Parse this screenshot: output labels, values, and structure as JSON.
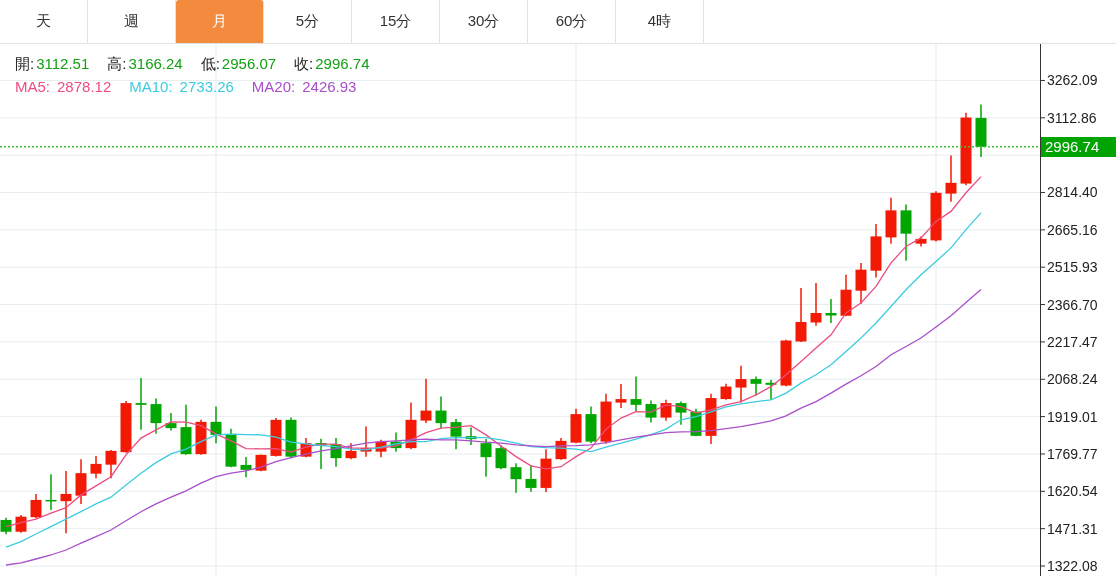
{
  "tabs": [
    {
      "label": "天",
      "selected": false
    },
    {
      "label": "週",
      "selected": false
    },
    {
      "label": "月",
      "selected": true
    },
    {
      "label": "5分",
      "selected": false
    },
    {
      "label": "15分",
      "selected": false
    },
    {
      "label": "30分",
      "selected": false
    },
    {
      "label": "60分",
      "selected": false
    },
    {
      "label": "4時",
      "selected": false
    }
  ],
  "chart": {
    "ohlc_legend": [
      {
        "label": "開:",
        "value": "3112.51"
      },
      {
        "label": "高:",
        "value": "3166.24"
      },
      {
        "label": "低:",
        "value": "2956.07"
      },
      {
        "label": "收:",
        "value": "2996.74"
      }
    ],
    "ma_legend": [
      {
        "value": "2878.12"
      },
      {
        "value": "2733.26"
      },
      {
        "value": "2426.93"
      }
    ],
    "chart_data": {
      "type": "candlestick",
      "grid": true,
      "ylim": [
        1282.1,
        3407.7
      ],
      "yticks": [
        1322.08,
        1471.31,
        1620.54,
        1769.77,
        1919.01,
        2068.24,
        2217.47,
        {
          "value": 2366.7,
          "label": "2366.70"
        },
        2515.93,
        2665.16,
        {
          "value": 2814.4,
          "label": "2814.40"
        },
        3112.86,
        3262.09
      ],
      "ohlc": [
        [
          1506,
          1515,
          1449,
          1459
        ],
        [
          1459,
          1526,
          1455,
          1519
        ],
        [
          1517,
          1610,
          1513,
          1586
        ],
        [
          1586,
          1689,
          1546,
          1581
        ],
        [
          1581,
          1702,
          1453,
          1610
        ],
        [
          1603,
          1749,
          1570,
          1693
        ],
        [
          1691,
          1762,
          1673,
          1730
        ],
        [
          1727,
          1786,
          1673,
          1782
        ],
        [
          1777,
          1981,
          1775,
          1973
        ],
        [
          1973,
          2073,
          1866,
          1966
        ],
        [
          1969,
          1991,
          1850,
          1893
        ],
        [
          1893,
          1933,
          1863,
          1873
        ],
        [
          1877,
          1966,
          1767,
          1769
        ],
        [
          1769,
          1906,
          1767,
          1898
        ],
        [
          1898,
          1959,
          1813,
          1846
        ],
        [
          1850,
          1870,
          1717,
          1719
        ],
        [
          1726,
          1758,
          1677,
          1706
        ],
        [
          1703,
          1768,
          1701,
          1766
        ],
        [
          1762,
          1913,
          1760,
          1906
        ],
        [
          1906,
          1915,
          1753,
          1759
        ],
        [
          1759,
          1833,
          1757,
          1813
        ],
        [
          1813,
          1830,
          1710,
          1803
        ],
        [
          1809,
          1833,
          1719,
          1753
        ],
        [
          1753,
          1813,
          1749,
          1782
        ],
        [
          1779,
          1879,
          1759,
          1793
        ],
        [
          1779,
          1826,
          1757,
          1819
        ],
        [
          1819,
          1855,
          1779,
          1793
        ],
        [
          1793,
          1975,
          1789,
          1906
        ],
        [
          1903,
          2070,
          1893,
          1943
        ],
        [
          1943,
          1999,
          1873,
          1893
        ],
        [
          1897,
          1909,
          1789,
          1839
        ],
        [
          1841,
          1875,
          1806,
          1829
        ],
        [
          1813,
          1829,
          1679,
          1757
        ],
        [
          1793,
          1805,
          1709,
          1713
        ],
        [
          1717,
          1733,
          1615,
          1669
        ],
        [
          1670,
          1725,
          1619,
          1634
        ],
        [
          1634,
          1789,
          1618,
          1751
        ],
        [
          1749,
          1833,
          1747,
          1822
        ],
        [
          1815,
          1950,
          1813,
          1929
        ],
        [
          1929,
          1959,
          1813,
          1819
        ],
        [
          1819,
          2010,
          1811,
          1979
        ],
        [
          1975,
          2049,
          1953,
          1989
        ],
        [
          1989,
          2079,
          1939,
          1966
        ],
        [
          1969,
          1983,
          1895,
          1915
        ],
        [
          1915,
          1986,
          1902,
          1973
        ],
        [
          1973,
          1979,
          1886,
          1935
        ],
        [
          1939,
          1950,
          1840,
          1842
        ],
        [
          1842,
          2010,
          1810,
          1993
        ],
        [
          1989,
          2050,
          1986,
          2039
        ],
        [
          2035,
          2122,
          1975,
          2069
        ],
        [
          2069,
          2079,
          2002,
          2050
        ],
        [
          2054,
          2066,
          1986,
          2046
        ],
        [
          2043,
          2226,
          2040,
          2223
        ],
        [
          2219,
          2433,
          2217,
          2297
        ],
        [
          2295,
          2453,
          2282,
          2333
        ],
        [
          2333,
          2389,
          2293,
          2323
        ],
        [
          2322,
          2486,
          2320,
          2426
        ],
        [
          2422,
          2533,
          2370,
          2506
        ],
        [
          2502,
          2689,
          2475,
          2639
        ],
        [
          2635,
          2793,
          2610,
          2743
        ],
        [
          2743,
          2766,
          2542,
          2650
        ],
        [
          2610,
          2639,
          2599,
          2629
        ],
        [
          2623,
          2819,
          2619,
          2813
        ],
        [
          2810,
          2962,
          2777,
          2853
        ],
        [
          2850,
          3133,
          2843,
          3114
        ],
        [
          3112.51,
          3166.24,
          2956.07,
          2996.74
        ]
      ],
      "series": [
        {
          "type": "line",
          "name": "MA5:",
          "color": "#ec4c82",
          "values": [
            1479,
            1495,
            1509,
            1533,
            1555,
            1606,
            1642,
            1679,
            1766,
            1833,
            1866,
            1898,
            1897,
            1883,
            1850,
            1822,
            1791,
            1790,
            1791,
            1777,
            1797,
            1809,
            1809,
            1793,
            1793,
            1793,
            1802,
            1826,
            1855,
            1873,
            1877,
            1883,
            1846,
            1802,
            1759,
            1722,
            1710,
            1719,
            1759,
            1793,
            1869,
            1913,
            1939,
            1937,
            1966,
            1959,
            1933,
            1946,
            1966,
            1979,
            2006,
            2039,
            2086,
            2139,
            2193,
            2246,
            2333,
            2373,
            2439,
            2533,
            2599,
            2633,
            2699,
            2739,
            2813,
            2878
          ]
        },
        {
          "type": "line",
          "name": "MA10:",
          "color": "#3ccbe0",
          "values": [
            1397,
            1419,
            1450,
            1479,
            1509,
            1539,
            1570,
            1597,
            1646,
            1693,
            1735,
            1770,
            1789,
            1819,
            1846,
            1849,
            1847,
            1846,
            1837,
            1817,
            1810,
            1803,
            1799,
            1789,
            1786,
            1797,
            1810,
            1819,
            1819,
            1831,
            1835,
            1835,
            1835,
            1826,
            1813,
            1799,
            1795,
            1793,
            1789,
            1779,
            1797,
            1813,
            1829,
            1847,
            1869,
            1906,
            1919,
            1938,
            1958,
            1970,
            1979,
            1986,
            2013,
            2053,
            2086,
            2126,
            2179,
            2233,
            2293,
            2359,
            2426,
            2486,
            2539,
            2593,
            2666,
            2733
          ]
        },
        {
          "type": "line",
          "name": "MA20:",
          "color": "#a84fc9",
          "values": [
            1326,
            1335,
            1350,
            1366,
            1386,
            1413,
            1439,
            1466,
            1503,
            1539,
            1570,
            1597,
            1622,
            1653,
            1679,
            1693,
            1702,
            1717,
            1739,
            1755,
            1769,
            1782,
            1791,
            1802,
            1813,
            1819,
            1822,
            1826,
            1829,
            1826,
            1826,
            1822,
            1817,
            1813,
            1806,
            1802,
            1799,
            1802,
            1803,
            1806,
            1815,
            1826,
            1837,
            1846,
            1855,
            1858,
            1859,
            1863,
            1871,
            1879,
            1890,
            1902,
            1922,
            1953,
            1979,
            2013,
            2049,
            2082,
            2119,
            2166,
            2199,
            2233,
            2277,
            2322,
            2375,
            2427
          ]
        }
      ],
      "ref_lines": [
        {
          "axis": "y",
          "value": 2996.74,
          "label": "2996.74",
          "color": "#3cbf3c"
        }
      ]
    }
  }
}
